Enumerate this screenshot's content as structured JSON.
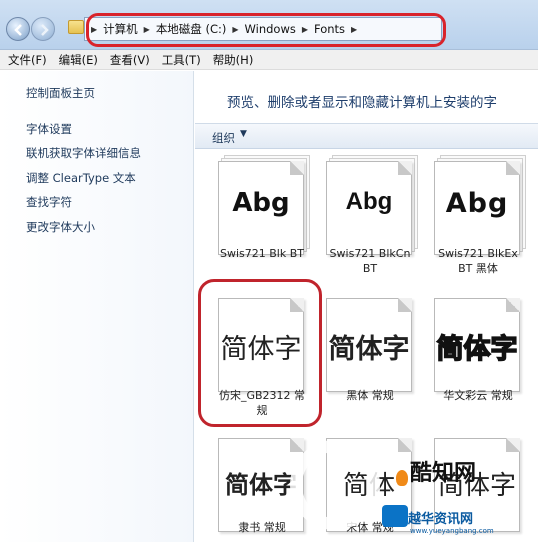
{
  "address": {
    "crumbs": [
      "计算机",
      "本地磁盘 (C:)",
      "Windows",
      "Fonts"
    ]
  },
  "menu": [
    "文件(F)",
    "编辑(E)",
    "查看(V)",
    "工具(T)",
    "帮助(H)"
  ],
  "left_pane": {
    "home": "控制面板主页",
    "links": [
      "字体设置",
      "联机获取字体详细信息",
      "调整 ClearType 文本",
      "查找字符",
      "更改字体大小"
    ]
  },
  "main": {
    "description": "预览、删除或者显示和隐藏计算机上安装的字",
    "organize": "组织"
  },
  "fonts": [
    {
      "sample": "Abg",
      "name_line1": "Swis721 Blk BT",
      "name_line2": ""
    },
    {
      "sample": "Abg",
      "name_line1": "Swis721 BlkCn",
      "name_line2": "BT"
    },
    {
      "sample": "Abg",
      "name_line1": "Swis721 BlkEx",
      "name_line2": "BT 黑体"
    },
    {
      "sample": "简体字",
      "name_line1": "仿宋_GB2312 常",
      "name_line2": "规"
    },
    {
      "sample": "简体字",
      "name_line1": "黑体 常规",
      "name_line2": ""
    },
    {
      "sample": "简体字",
      "name_line1": "华文彩云 常规",
      "name_line2": ""
    },
    {
      "sample": "简体字",
      "name_line1": "隶书 常规",
      "name_line2": ""
    },
    {
      "sample": "简体",
      "name_line1": "宋体 常规",
      "name_line2": ""
    },
    {
      "sample": "简体字",
      "name_line1": "",
      "name_line2": ""
    }
  ],
  "watermark": {
    "brand": "酷知网",
    "site": "越华资讯网",
    "url": "www.yueyangbang.com"
  },
  "colors": {
    "highlight": "#d9232b",
    "link": "#1e395b",
    "description": "#1e3e6c"
  }
}
